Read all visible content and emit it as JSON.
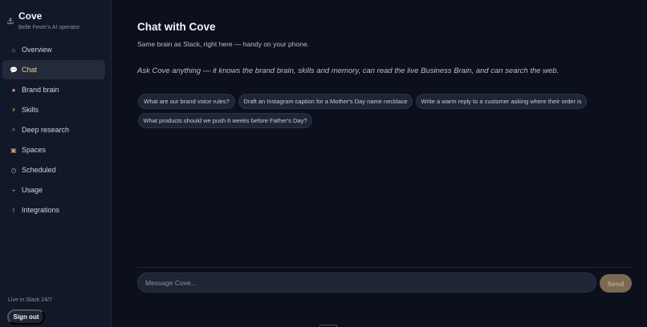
{
  "brand": {
    "title": "Cove",
    "subtitle": "Belle Fever's AI operator",
    "icon": "anchor-icon"
  },
  "nav": [
    {
      "label": "Overview",
      "icon": "home-icon",
      "active": false
    },
    {
      "label": "Chat",
      "icon": "chat-bubble-icon",
      "active": true
    },
    {
      "label": "Brand brain",
      "icon": "brain-icon",
      "active": false
    },
    {
      "label": "Skills",
      "icon": "lightning-icon",
      "active": false
    },
    {
      "label": "Deep research",
      "icon": "magnifier-icon",
      "active": false
    },
    {
      "label": "Spaces",
      "icon": "box-icon",
      "active": false
    },
    {
      "label": "Scheduled",
      "icon": "clock-icon",
      "active": false
    },
    {
      "label": "Usage",
      "icon": "trend-icon",
      "active": false
    },
    {
      "label": "Integrations",
      "icon": "plug-icon",
      "active": false
    }
  ],
  "footer": {
    "live_text": "Live in Slack 24/7",
    "signout_label": "Sign out"
  },
  "main": {
    "title": "Chat with Cove",
    "subtitle": "Same brain as Slack, right here — handy on your phone.",
    "intro": "Ask Cove anything — it knows the brand brain, skills and memory, can read the live Business Brain, and can search the web.",
    "suggestions": [
      "What are our brand voice rules?",
      "Draft an Instagram caption for a Mother's Day name necklace",
      "Write a warm reply to a customer asking where their order is",
      "What products should we push 6 weeks before Father's Day?"
    ]
  },
  "composer": {
    "placeholder": "Message Cove...",
    "send_label": "Send"
  },
  "colors": {
    "background": "#0b101c",
    "sidebar": "#111827",
    "accent": "#f5c98f",
    "send_button": "#7a6a52"
  }
}
